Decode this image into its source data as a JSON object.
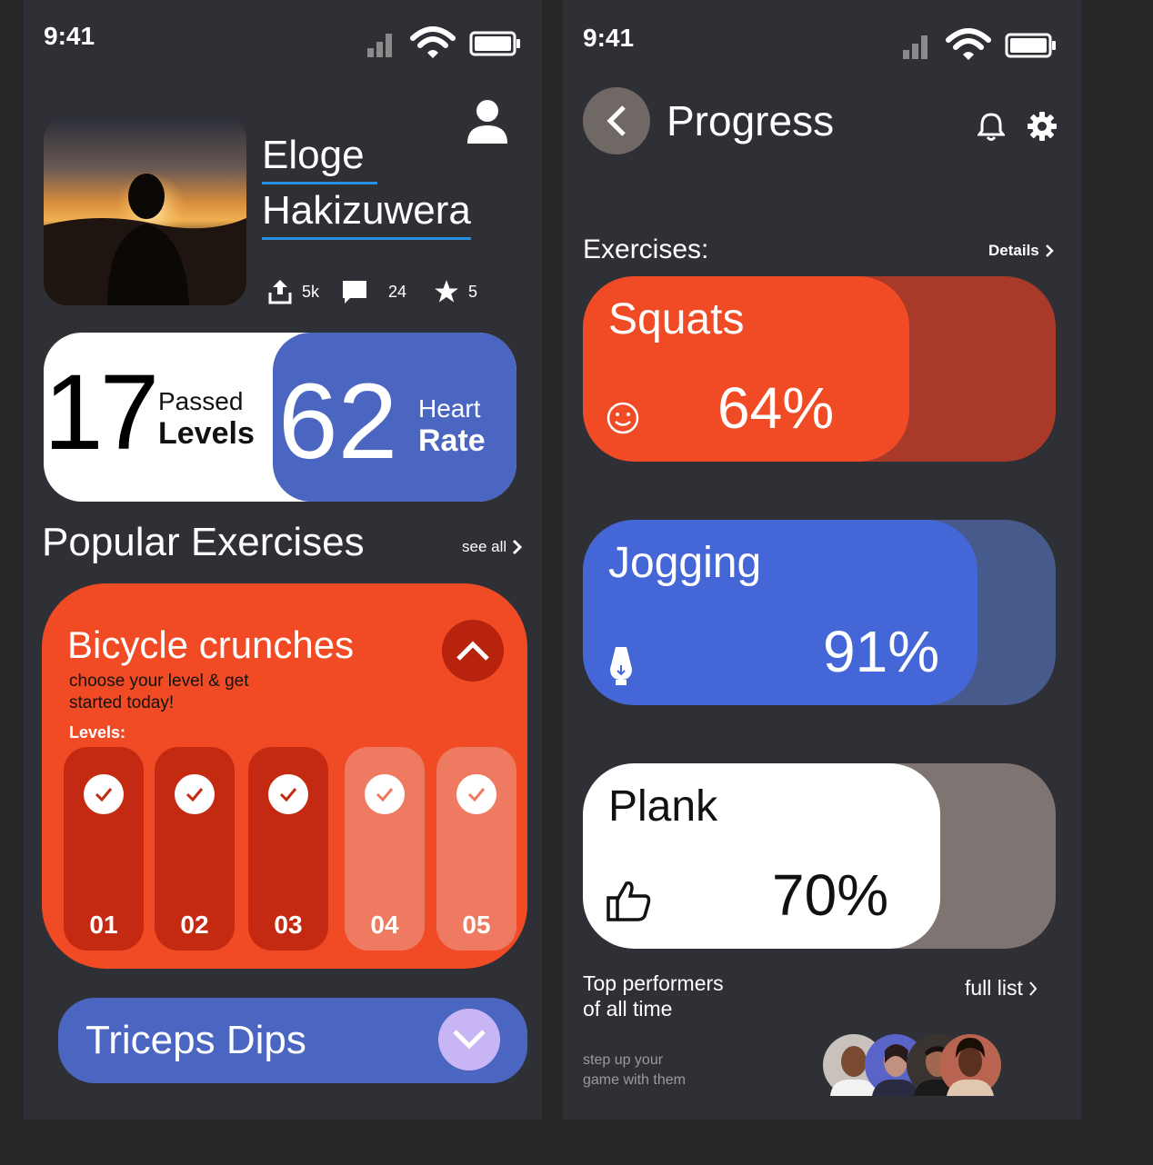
{
  "left": {
    "status": {
      "time": "9:41"
    },
    "profile": {
      "first_name": "Eloge",
      "last_name": "Hakizuwera",
      "stats": [
        {
          "icon": "share-icon",
          "value": "5k"
        },
        {
          "icon": "comment-icon",
          "value": "24"
        },
        {
          "icon": "star-icon",
          "value": "5"
        }
      ]
    },
    "metrics": {
      "levels_number": "17",
      "levels_label_top": "Passed",
      "levels_label_bottom": "Levels",
      "heart_number": "62",
      "heart_label_top": "Heart",
      "heart_label_bottom": "Rate"
    },
    "popular": {
      "title": "Popular Exercises",
      "see_all": "see all"
    },
    "bicycle": {
      "title": "Bicycle crunches",
      "subtitle_line1": "choose your level & get",
      "subtitle_line2": "started today!",
      "levels_label": "Levels:",
      "levels": [
        {
          "label": "01",
          "done": true
        },
        {
          "label": "02",
          "done": true
        },
        {
          "label": "03",
          "done": true
        },
        {
          "label": "04",
          "done": false
        },
        {
          "label": "05",
          "done": false
        }
      ]
    },
    "triceps": {
      "title": "Triceps Dips"
    }
  },
  "right": {
    "status": {
      "time": "9:41"
    },
    "header": {
      "title": "Progress"
    },
    "exercises": {
      "label": "Exercises:",
      "details": "Details"
    },
    "cards": [
      {
        "name": "Squats",
        "percent": "64%",
        "icon": "smiley-icon",
        "fill": 0.64,
        "front": "#f04b24",
        "back": "#a93a29",
        "text": "#ffffff"
      },
      {
        "name": "Jogging",
        "percent": "91%",
        "icon": "lightbulb-icon",
        "fill": 0.91,
        "front": "#4466d6",
        "back": "#465a8c",
        "text": "#ffffff"
      },
      {
        "name": "Plank",
        "percent": "70%",
        "icon": "thumbs-up-icon",
        "fill": 0.7,
        "front": "#ffffff",
        "back": "#7e7472",
        "text": "#111111"
      }
    ],
    "performers": {
      "title_line1": "Top performers",
      "title_line2": "of all time",
      "full_list": "full list",
      "sub_line1": "step up your",
      "sub_line2": "game with them"
    }
  }
}
